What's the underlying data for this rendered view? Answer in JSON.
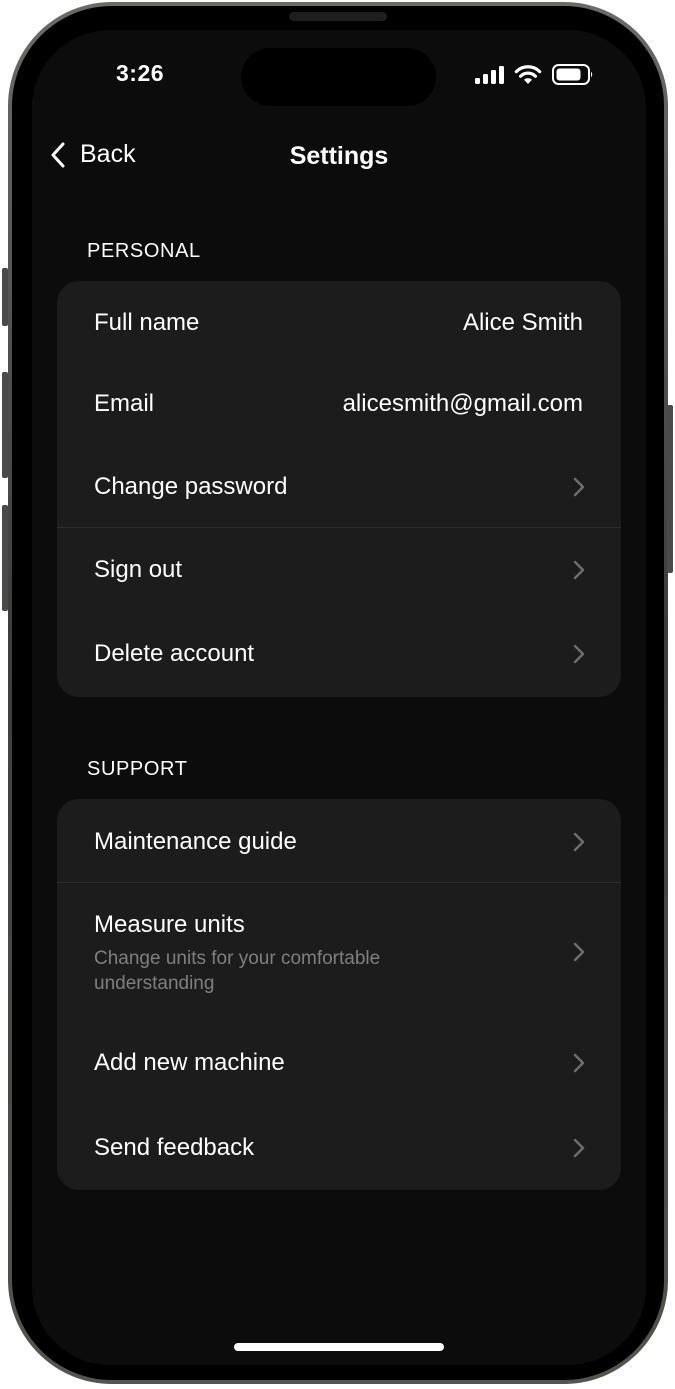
{
  "status_bar": {
    "time": "3:26",
    "icons": [
      "signal-icon",
      "wifi-icon",
      "battery-icon"
    ]
  },
  "nav": {
    "back_label": "Back",
    "title": "Settings"
  },
  "personal": {
    "section_label": "PERSONAL",
    "items": [
      {
        "label": "Full name",
        "value": "Alice Smith"
      },
      {
        "label": "Email",
        "value": "alicesmith@gmail.com"
      },
      {
        "label": "Change password"
      },
      {
        "label": "Sign out"
      },
      {
        "label": "Delete account"
      }
    ]
  },
  "support": {
    "section_label": "SUPPORT",
    "items": [
      {
        "label": "Maintenance guide"
      },
      {
        "label": "Measure units",
        "subtitle": "Change units for your comfortable understanding"
      },
      {
        "label": "Add new machine"
      },
      {
        "label": "Send feedback"
      }
    ]
  },
  "colors": {
    "background": "#0c0c0c",
    "card": "#1c1c1c",
    "text": "#ffffff",
    "secondary_text": "#7f7f7f",
    "chevron": "#6e6e6e"
  }
}
